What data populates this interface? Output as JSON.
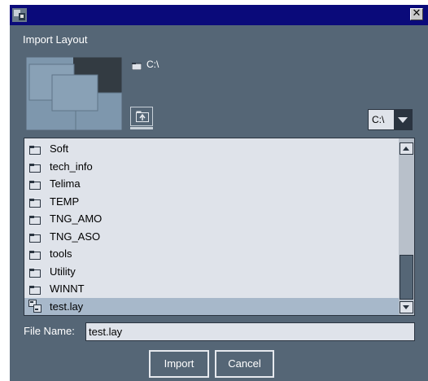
{
  "window": {
    "app_icon": "application-icon",
    "close_icon": "close-icon",
    "close_glyph": "✕"
  },
  "dialog": {
    "title": "Import Layout"
  },
  "preview": {
    "icon": "layout-preview-thumbnail"
  },
  "path": {
    "icon": "folder-icon",
    "text": "C:\\"
  },
  "toolbar": {
    "up_icon": "up-folder-icon"
  },
  "drive": {
    "selected": "C:\\"
  },
  "files": [
    {
      "name": "Soft",
      "type": "folder"
    },
    {
      "name": "tech_info",
      "type": "folder"
    },
    {
      "name": "Telima",
      "type": "folder"
    },
    {
      "name": "TEMP",
      "type": "folder"
    },
    {
      "name": "TNG_AMO",
      "type": "folder"
    },
    {
      "name": "TNG_ASO",
      "type": "folder"
    },
    {
      "name": "tools",
      "type": "folder"
    },
    {
      "name": "Utility",
      "type": "folder"
    },
    {
      "name": "WINNT",
      "type": "folder"
    },
    {
      "name": "test.lay",
      "type": "file",
      "selected": true
    }
  ],
  "file_name": {
    "label": "File Name:",
    "value": "test.lay"
  },
  "buttons": {
    "import": "Import",
    "cancel": "Cancel"
  },
  "colors": {
    "titlebar": "#0a0a7a",
    "dialog_bg": "#556676",
    "list_bg": "#dfe3ea",
    "selection": "#a7b8ca"
  }
}
